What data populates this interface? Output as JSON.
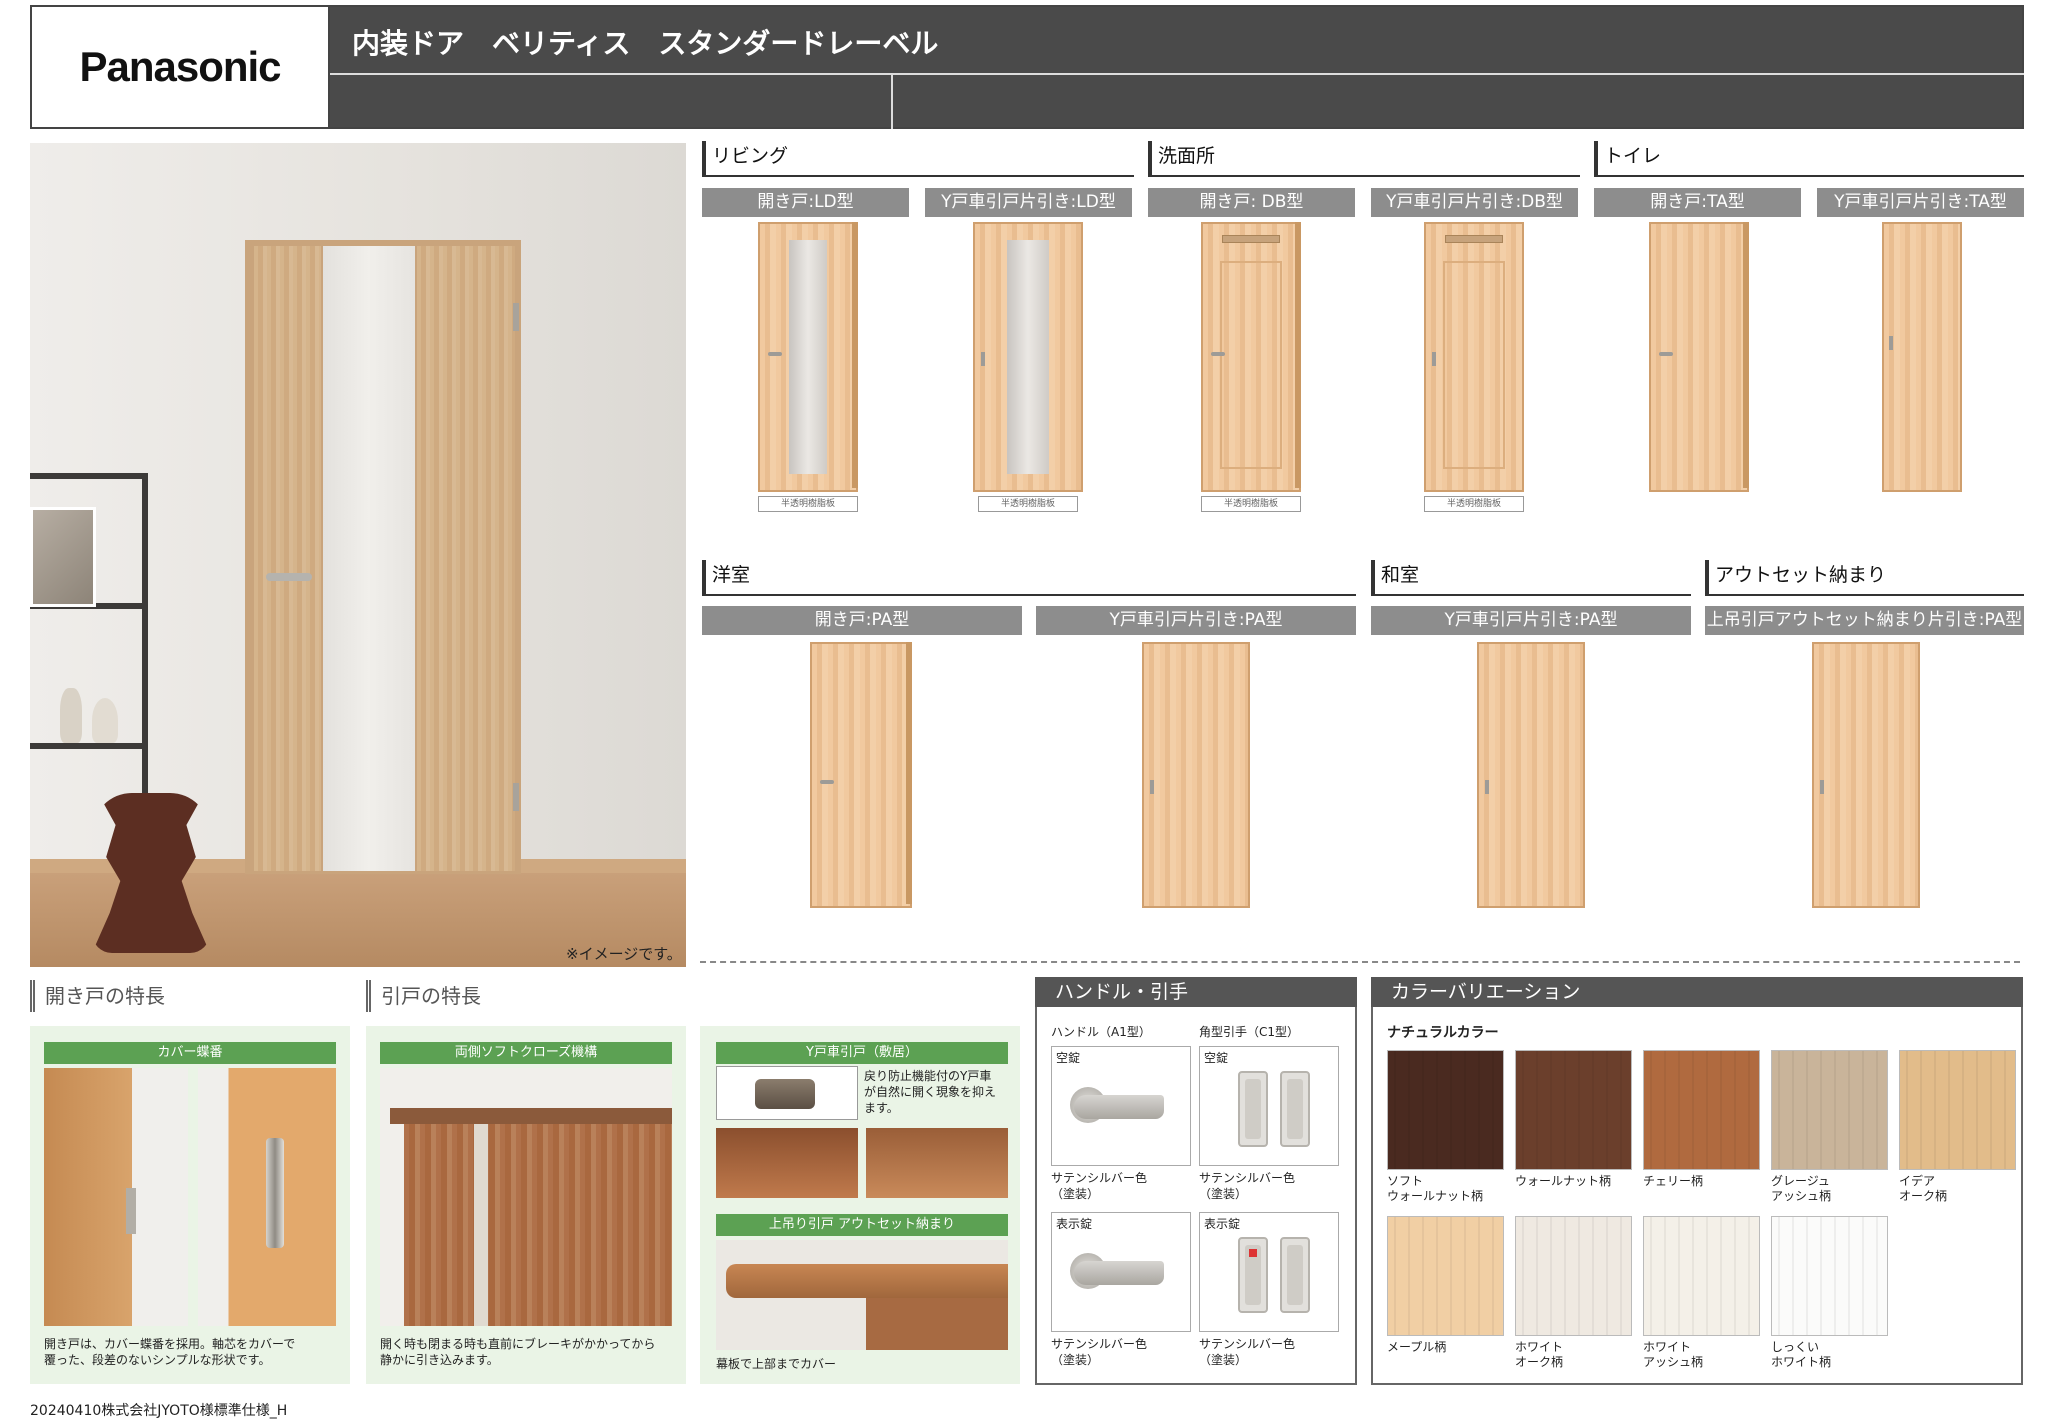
{
  "header": {
    "brand": "Panasonic",
    "title": "内装ドア　ベリティス　スタンダードレーベル"
  },
  "room_photo": {
    "note": "※イメージです。"
  },
  "sections": {
    "living": "リビング",
    "washroom": "洗面所",
    "toilet": "トイレ",
    "western": "洋室",
    "japanese": "和室",
    "outset": "アウトセット納まり"
  },
  "doors": [
    {
      "label": "開き戸:LD型",
      "tag": "半透明樹脂板"
    },
    {
      "label": "Y戸車引戸片引き:LD型",
      "tag": "半透明樹脂板"
    },
    {
      "label": "開き戸: DB型",
      "tag": "半透明樹脂板"
    },
    {
      "label": "Y戸車引戸片引き:DB型",
      "tag": "半透明樹脂板"
    },
    {
      "label": "開き戸:TA型"
    },
    {
      "label": "Y戸車引戸片引き:TA型"
    },
    {
      "label": "開き戸:PA型"
    },
    {
      "label": "Y戸車引戸片引き:PA型"
    },
    {
      "label": "Y戸車引戸片引き:PA型"
    },
    {
      "label": "上吊引戸アウトセット納まり片引き:PA型"
    }
  ],
  "features": {
    "hinged_heading": "開き戸の特長",
    "sliding_heading": "引戸の特長",
    "cover_hinge": {
      "title": "カバー蝶番",
      "desc1": "開き戸は、カバー蝶番を採用。軸芯をカバーで",
      "desc2": "覆った、段差のないシンプルな形状です。"
    },
    "soft_close": {
      "title": "両側ソフトクローズ機構",
      "desc1": "開く時も閉まる時も直前にブレーキがかかってから",
      "desc2": "静かに引き込みます。"
    },
    "y_roller": {
      "title": "Y戸車引戸（敷居）",
      "desc1": "戻り防止機能付のY戸車",
      "desc2": "が自然に開く現象を抑え",
      "desc3": "ます。"
    },
    "outset": {
      "title": "上吊り引戸 アウトセット納まり",
      "desc": "幕板で上部までカバー"
    }
  },
  "handles": {
    "heading": "ハンドル・引手",
    "col1": "ハンドル（A1型）",
    "col2": "角型引手（C1型）",
    "cells": [
      {
        "lock": "空錠",
        "color1": "サテンシルバー色",
        "color2": "（塗装）"
      },
      {
        "lock": "空錠",
        "color1": "サテンシルバー色",
        "color2": "（塗装）"
      },
      {
        "lock": "表示錠",
        "color1": "サテンシルバー色",
        "color2": "（塗装）"
      },
      {
        "lock": "表示錠",
        "color1": "サテンシルバー色",
        "color2": "（塗装）"
      }
    ]
  },
  "colors": {
    "heading": "カラーバリエーション",
    "group": "ナチュラルカラー",
    "swatches": [
      {
        "name": "ソフト\nウォールナット柄",
        "hex": "#4a2a20"
      },
      {
        "name": "ウォールナット柄",
        "hex": "#6b3f2c"
      },
      {
        "name": "チェリー柄",
        "hex": "#b06a3f"
      },
      {
        "name": "グレージュ\nアッシュ柄",
        "hex": "#c9b49a"
      },
      {
        "name": "イデア\nオーク柄",
        "hex": "#e2bc8a"
      },
      {
        "name": "メープル柄",
        "hex": "#f1cfa4"
      },
      {
        "name": "ホワイト\nオーク柄",
        "hex": "#efe9e1"
      },
      {
        "name": "ホワイト\nアッシュ柄",
        "hex": "#f4f0e8"
      },
      {
        "name": "しっくい\nホワイト柄",
        "hex": "#fbfbfa"
      }
    ]
  },
  "footer": "20240410株式会社JYOTO様標準仕様_H"
}
